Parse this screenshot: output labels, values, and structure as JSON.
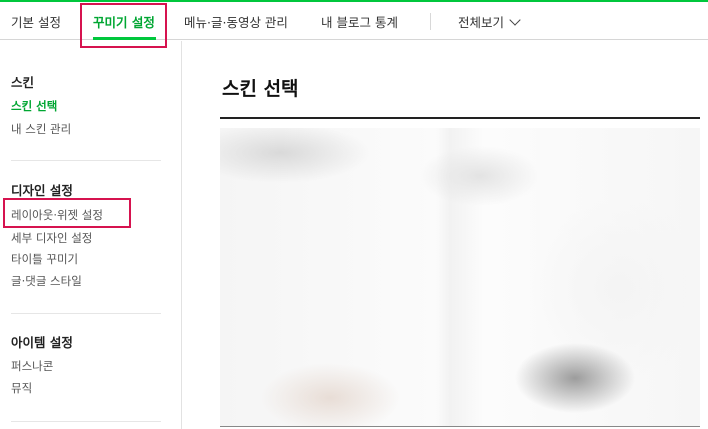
{
  "nav": {
    "tabs": [
      {
        "label": "기본 설정"
      },
      {
        "label": "꾸미기 설정"
      },
      {
        "label": "메뉴·글·동영상 관리"
      },
      {
        "label": "내 블로그 통계"
      },
      {
        "label": "전체보기"
      }
    ],
    "active_tab": "꾸미기 설정"
  },
  "sidebar": {
    "sections": [
      {
        "heading": "스킨",
        "items": [
          {
            "label": "스킨 선택"
          },
          {
            "label": "내 스킨 관리"
          }
        ]
      },
      {
        "heading": "디자인 설정",
        "items": [
          {
            "label": "레이아웃·위젯 설정"
          },
          {
            "label": "세부 디자인 설정"
          },
          {
            "label": "타이틀 꾸미기"
          },
          {
            "label": "글·댓글 스타일"
          }
        ]
      },
      {
        "heading": "아이템 설정",
        "items": [
          {
            "label": "퍼스나콘"
          },
          {
            "label": "뮤직"
          }
        ]
      }
    ],
    "active_item": "스킨 선택"
  },
  "main": {
    "title": "스킨 선택"
  },
  "colors": {
    "accent": "#00c73c",
    "highlight": "#d6134f"
  },
  "icons": {
    "dropdown": "chevron-down-icon"
  }
}
